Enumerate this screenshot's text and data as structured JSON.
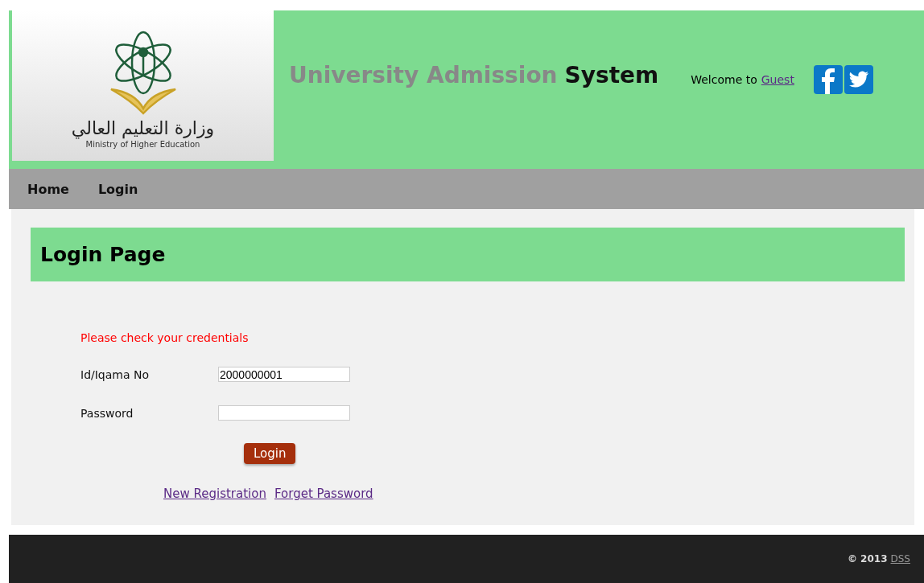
{
  "logo": {
    "arabic": "وزارة التعليم العالي",
    "english": "Ministry of Higher Education"
  },
  "header": {
    "title_muted": "University Admission",
    "title_strong": "System",
    "welcome": "Welcome to",
    "user_link": "Guest"
  },
  "nav": [
    {
      "label": "Home"
    },
    {
      "label": "Login"
    }
  ],
  "page_title": "Login Page",
  "error": "Please check your credentials",
  "fields": [
    {
      "label": "Id/Iqama No",
      "value": "2000000001"
    },
    {
      "label": "Password"
    }
  ],
  "submit": "Login",
  "links": [
    "New Registration",
    "Forget Password"
  ],
  "footer": {
    "copyright": "© 2013",
    "link": "DSS"
  }
}
